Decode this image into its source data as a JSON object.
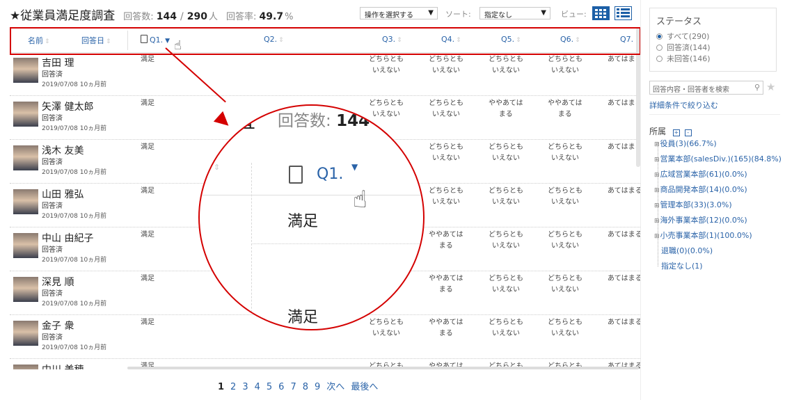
{
  "header": {
    "title": "★従業員満足度調査",
    "responses_label": "回答数:",
    "responses": "144",
    "sep": "/",
    "total": "290",
    "unit": "人",
    "rate_label": "回答率:",
    "rate": "49.7",
    "rate_unit": "%"
  },
  "toolbar": {
    "action_select": "操作を選択する",
    "action_arrow": "▼",
    "sort_label": "ソート:",
    "sort_value": "指定なし",
    "sort_arrow": "▼",
    "view_label": "ビュー:"
  },
  "columns": {
    "name": "名前",
    "date": "回答日",
    "q1": "Q1.",
    "q2": "Q2.",
    "q3": "Q3.",
    "q4": "Q4.",
    "q5": "Q5.",
    "q6": "Q6.",
    "q7": "Q7.",
    "sort_icon": "⇕",
    "sort_down": "▼"
  },
  "rows": [
    {
      "name": "吉田 理",
      "status": "回答済",
      "date": "2019/07/08 10ヵ月前",
      "q1": "満足",
      "q3": "どちらとも\nいえない",
      "q4": "どちらとも\nいえない",
      "q5": "どちらとも\nいえない",
      "q6": "どちらとも\nいえない",
      "q7": "あてはまる"
    },
    {
      "name": "矢澤 健太郎",
      "status": "回答済",
      "date": "2019/07/08 10ヵ月前",
      "q1": "満足",
      "q3": "どちらとも\nいえない",
      "q4": "どちらとも\nいえない",
      "q5": "ややあては\nまる",
      "q6": "ややあては\nまる",
      "q7": "あてはまる"
    },
    {
      "name": "浅木 友美",
      "status": "回答済",
      "date": "2019/07/08 10ヵ月前",
      "q1": "満足",
      "q3": "",
      "q4": "どちらとも\nいえない",
      "q5": "どちらとも\nいえない",
      "q6": "どちらとも\nいえない",
      "q7": "あてはまる"
    },
    {
      "name": "山田 雅弘",
      "status": "回答済",
      "date": "2019/07/08 10ヵ月前",
      "q1": "満足",
      "q3": "",
      "q4": "どちらとも\nいえない",
      "q5": "どちらとも\nいえない",
      "q6": "どちらとも\nいえない",
      "q7": "あてはまる"
    },
    {
      "name": "中山 由紀子",
      "status": "回答済",
      "date": "2019/07/08 10ヵ月前",
      "q1": "満足",
      "q3": "",
      "q4": "ややあては\nまる",
      "q5": "どちらとも\nいえない",
      "q6": "どちらとも\nいえない",
      "q7": "あてはまる"
    },
    {
      "name": "深見 順",
      "status": "回答済",
      "date": "2019/07/08 10ヵ月前",
      "q1": "満足",
      "q3": "",
      "q4": "ややあては\nまる",
      "q5": "どちらとも\nいえない",
      "q6": "どちらとも\nいえない",
      "q7": "あてはまる"
    },
    {
      "name": "金子 衆",
      "status": "回答済",
      "date": "2019/07/08 10ヵ月前",
      "q1": "満足",
      "q3": "どちらとも\nいえない",
      "q4": "ややあては\nまる",
      "q5": "どちらとも\nいえない",
      "q6": "どちらとも\nいえない",
      "q7": "あてはまる"
    },
    {
      "name": "中川 美穂",
      "status": "",
      "date": "",
      "q1": "満足",
      "q3": "どちらとも",
      "q4": "ややあては",
      "q5": "どちらとも",
      "q6": "どちらとも",
      "q7": "あてはまる"
    }
  ],
  "pagination": {
    "pages": [
      "1",
      "2",
      "3",
      "4",
      "5",
      "6",
      "7",
      "8",
      "9"
    ],
    "current": "1",
    "next": "次へ",
    "last": "最後へ"
  },
  "sidebar": {
    "status_title": "ステータス",
    "status_options": [
      {
        "label": "すべて(290)",
        "selected": true
      },
      {
        "label": "回答済(144)",
        "selected": false
      },
      {
        "label": "未回答(146)",
        "selected": false
      }
    ],
    "search_placeholder": "回答内容・回答者を検索",
    "detail_link": "詳細条件で絞り込む",
    "dept_title": "所属",
    "expand_all": "+",
    "collapse_all": "-",
    "depts": [
      {
        "label": "役員(3)(66.7%)",
        "expandable": true
      },
      {
        "label": "営業本部(salesDiv.)(165)(84.8%)",
        "expandable": true
      },
      {
        "label": "広域営業本部(61)(0.0%)",
        "expandable": true
      },
      {
        "label": "商品開発本部(14)(0.0%)",
        "expandable": true
      },
      {
        "label": "管理本部(33)(3.0%)",
        "expandable": true
      },
      {
        "label": "海外事業本部(12)(0.0%)",
        "expandable": true
      },
      {
        "label": "小売事業本部(1)(100.0%)",
        "expandable": true
      },
      {
        "label": "退職(0)(0.0%)",
        "expandable": false
      },
      {
        "label": "指定なし(1)",
        "expandable": false
      }
    ]
  },
  "magnifier": {
    "title_fragment": "査",
    "stat_label": "回答数:",
    "stat_value": "144",
    "col_label": "Q1.",
    "row1_value": "満足",
    "row2_value": "満足"
  },
  "colors": {
    "accent": "#1c5fa6",
    "link": "#2a63a8",
    "highlight": "#d40000"
  },
  "icons": {
    "pointer": "pointer-hand-icon",
    "clipboard": "clipboard-icon",
    "search": "search-icon",
    "star": "star-icon",
    "tile_view": "tile-view-icon",
    "list_view": "list-view-icon"
  }
}
